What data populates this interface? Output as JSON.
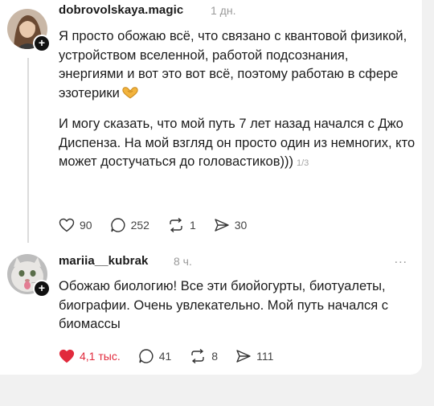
{
  "posts": [
    {
      "username": "dobrovolskaya.magic",
      "time": "1 дн.",
      "paragraph1": "Я просто обожаю всё, что связано с квантовой физикой, устройством вселенной, работой подсознания, энергиями и вот это вот всё, поэтому работаю в сфере эзотерики",
      "paragraph2": "И могу сказать, что мой путь 7 лет назад начался с Джо Диспенза. На мой взгляд он просто один из немногих, кто может достучаться до головастиков)))",
      "page_count": "1/3",
      "likes": "90",
      "comments": "252",
      "reposts": "1",
      "shares": "30",
      "emoji_icon": "heart-hands-icon"
    },
    {
      "username": "mariia__kubrak",
      "time": "8 ч.",
      "text": "Обожаю биологию! Все эти биойогурты, биотуалеты, биографии. Очень увлекательно. Мой путь начался с биомассы",
      "likes": "4,1 тыс.",
      "comments": "41",
      "reposts": "8",
      "shares": "111",
      "more": "..."
    }
  ],
  "colors": {
    "like_active": "#e12a3c",
    "text": "#1c1c1c",
    "muted": "#9a9a9a"
  }
}
